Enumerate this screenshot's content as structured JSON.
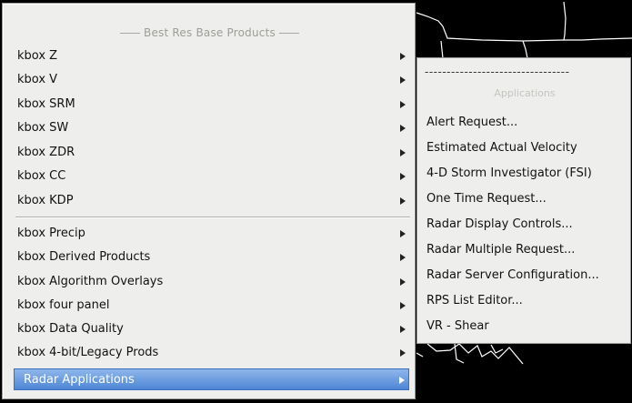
{
  "main_menu": {
    "header": "Best Res Base Products",
    "items": [
      {
        "label": "kbox Z"
      },
      {
        "label": "kbox V"
      },
      {
        "label": "kbox SRM"
      },
      {
        "label": "kbox SW"
      },
      {
        "label": "kbox ZDR"
      },
      {
        "label": "kbox CC"
      },
      {
        "label": "kbox KDP"
      },
      {
        "label": "kbox Precip"
      },
      {
        "label": "kbox Derived Products"
      },
      {
        "label": "kbox Algorithm Overlays"
      },
      {
        "label": "kbox four panel"
      },
      {
        "label": "kbox Data Quality"
      },
      {
        "label": "kbox 4-bit/Legacy Prods"
      },
      {
        "label": "Radar Applications"
      }
    ],
    "selected_item": "Radar Applications"
  },
  "submenu": {
    "dashes": "---------------------------------",
    "header": "Applications",
    "items": [
      {
        "label": "Alert Request..."
      },
      {
        "label": "Estimated Actual Velocity"
      },
      {
        "label": "4-D Storm Investigator (FSI)"
      },
      {
        "label": "One Time Request..."
      },
      {
        "label": "Radar Display Controls..."
      },
      {
        "label": "Radar Multiple Request..."
      },
      {
        "label": "Radar Server Configuration..."
      },
      {
        "label": "RPS List Editor..."
      },
      {
        "label": "VR - Shear"
      }
    ]
  },
  "colors": {
    "menu_bg": "#eeeeec",
    "selection": "#4d86d6",
    "map_bg": "#000000",
    "map_lines": "#ffffff"
  }
}
